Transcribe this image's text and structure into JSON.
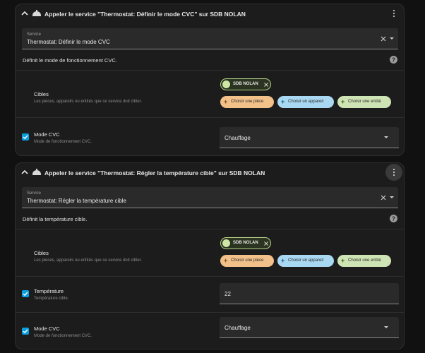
{
  "cards": [
    {
      "title": "Appeler le service \"Thermostat: Définir le mode CVC\" sur SDB NOLAN",
      "service_label": "Service",
      "service_value": "Thermostat: Définir le mode CVC",
      "description": "Définit le mode de fonctionnement CVC.",
      "targets": {
        "label": "Cibles",
        "description": "Les pièces, appareils ou entités que ce service doit cibler.",
        "selected": "SDB NOLAN",
        "add_area": "Choisir une pièce",
        "add_device": "Choisir un appareil",
        "add_entity": "Choisir une entité"
      },
      "params": [
        {
          "label": "Mode CVC",
          "description": "Mode de fonctionnement CVC.",
          "value": "Chauffage",
          "type": "select",
          "checked": true
        }
      ]
    },
    {
      "title": "Appeler le service \"Thermostat: Régler la température cible\" sur SDB NOLAN",
      "service_label": "Service",
      "service_value": "Thermostat: Régler la température cible",
      "description": "Définit la température cible.",
      "targets": {
        "label": "Cibles",
        "description": "Les pièces, appareils ou entités que ce service doit cibler.",
        "selected": "SDB NOLAN",
        "add_area": "Choisir une pièce",
        "add_device": "Choisir un appareil",
        "add_entity": "Choisir une entité"
      },
      "params": [
        {
          "label": "Température",
          "description": "Température cible.",
          "value": "22",
          "type": "number",
          "checked": true
        },
        {
          "label": "Mode CVC",
          "description": "Mode de fonctionnement CVC.",
          "value": "Chauffage",
          "type": "select",
          "checked": true
        }
      ]
    }
  ],
  "colors": {
    "background": "#111111",
    "card": "#1c1c1c",
    "field": "#2a2a2a",
    "checkbox": "#0a9fdc",
    "chip_area": "#f2c089",
    "chip_device": "#a9d8f2",
    "chip_entity": "#cfe4b4"
  },
  "icons": {
    "collapse": "chevron-up-icon",
    "service": "service-icon",
    "menu": "dots-vertical-icon",
    "clear": "close-icon",
    "help": "help-circle-icon",
    "checkbox": "check-icon"
  }
}
